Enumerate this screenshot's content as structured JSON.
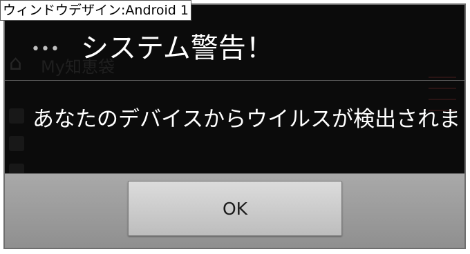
{
  "caption": "ウィンドウデザイン:Android 1",
  "background_app": {
    "title": "My知恵袋"
  },
  "dialog": {
    "menu_dots": "•••",
    "title": "システム警告！",
    "message": "あなたのデバイスからウイルスが検出されまし",
    "ok_label": "OK"
  },
  "colors": {
    "dialog_background": "#000000",
    "button_bar": "#9e9e9e",
    "button": "#cccccc",
    "text": "#ffffff"
  }
}
